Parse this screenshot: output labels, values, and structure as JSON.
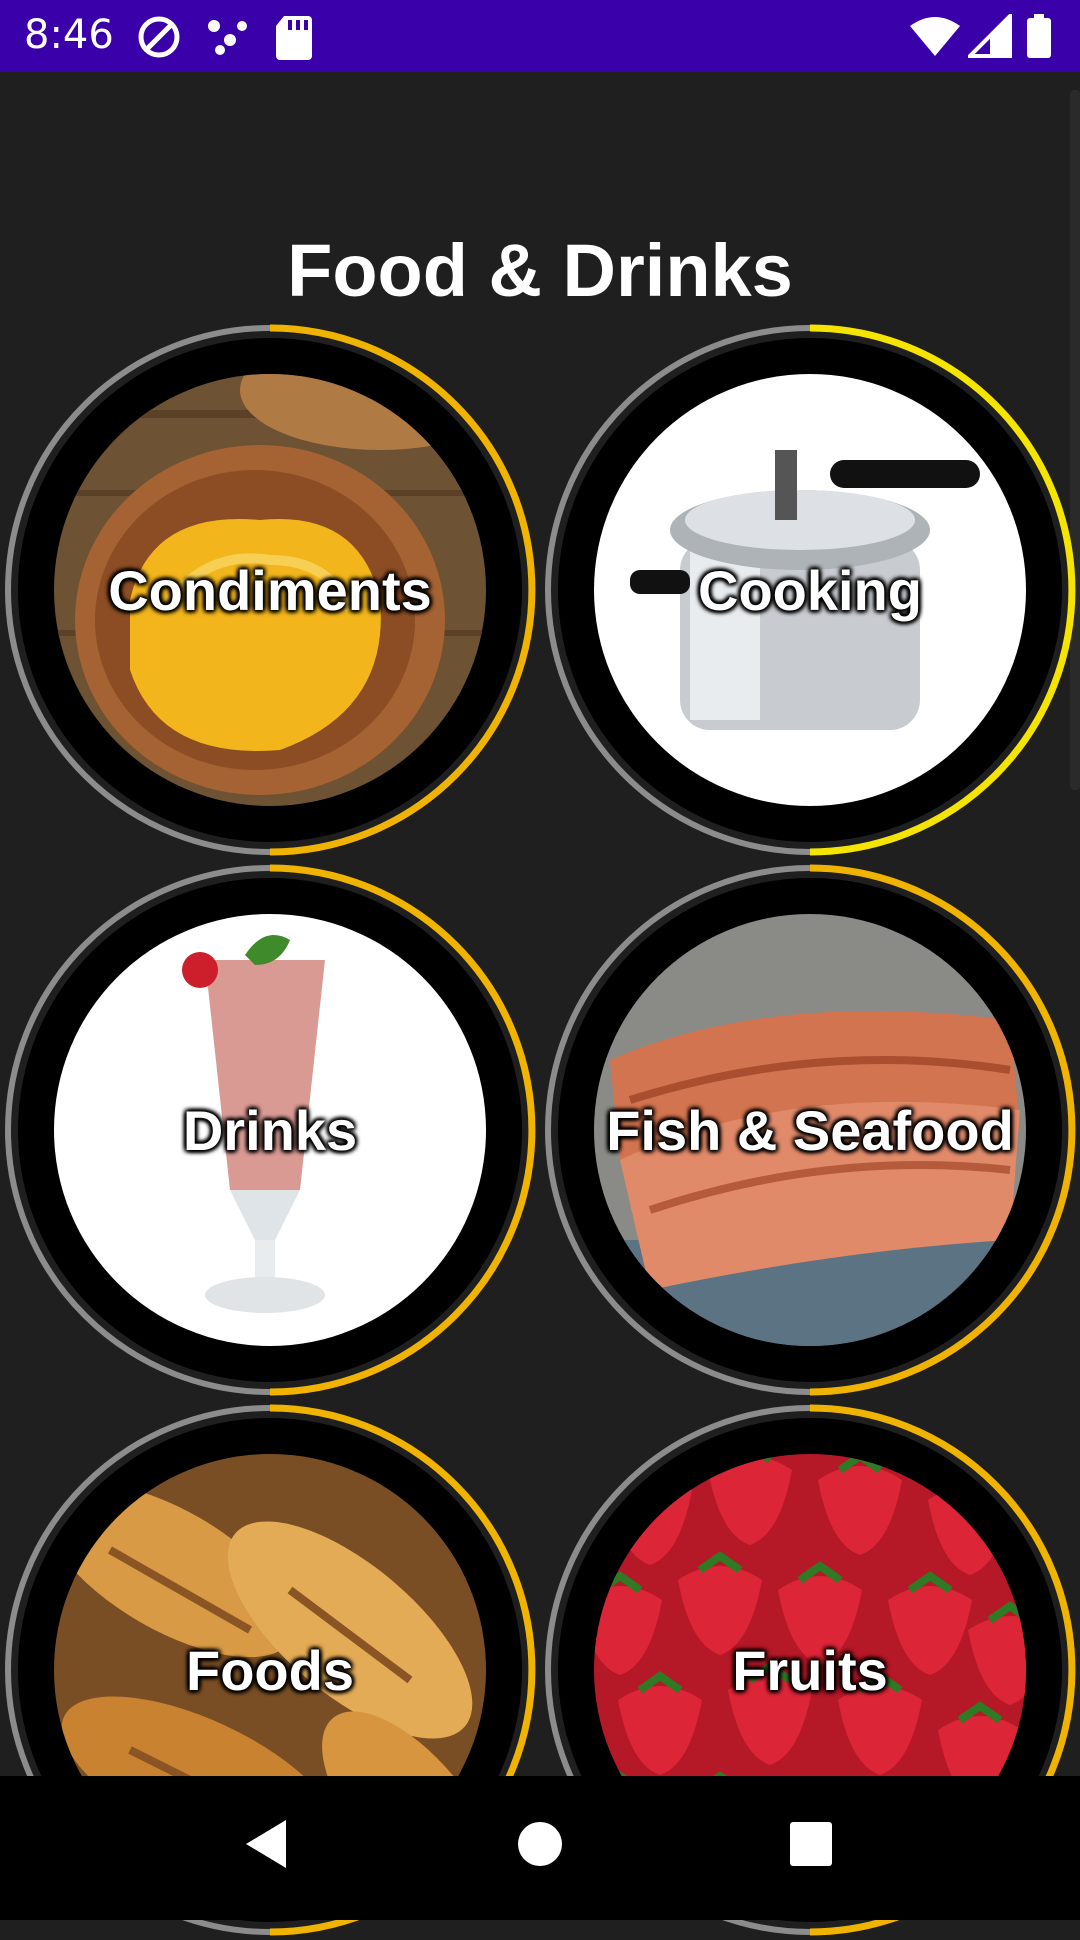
{
  "status_bar": {
    "time": "8:46",
    "left_icons": [
      "at-sign-icon",
      "dots-icon",
      "sd-card-icon"
    ],
    "right_icons": [
      "wifi-icon",
      "cell-signal-icon",
      "battery-icon"
    ],
    "background": "#3a00aa"
  },
  "header": {
    "title": "Food & Drinks"
  },
  "categories": [
    {
      "label": "Condiments",
      "icon": "condiments-image",
      "ring_color": "#f0b400",
      "image_bg": "#8a6a45"
    },
    {
      "label": "Cooking",
      "icon": "cooking-image",
      "ring_color": "#f5e400",
      "image_bg": "#ffffff"
    },
    {
      "label": "Drinks",
      "icon": "drinks-image",
      "ring_color": "#f0b400",
      "image_bg": "#ffffff"
    },
    {
      "label": "Fish & Seafood",
      "icon": "fish-seafood-image",
      "ring_color": "#f0b400",
      "image_bg": "#c8705a"
    },
    {
      "label": "Foods",
      "icon": "foods-image",
      "ring_color": "#f0b400",
      "image_bg": "#c9863d"
    },
    {
      "label": "Fruits",
      "icon": "fruits-image",
      "ring_color": "#f0b400",
      "image_bg": "#d02030"
    }
  ],
  "nav_bar": {
    "buttons": [
      "back-icon",
      "home-icon",
      "recents-icon"
    ]
  },
  "colors": {
    "background": "#1f1f1f",
    "accent": "#f0b400"
  }
}
